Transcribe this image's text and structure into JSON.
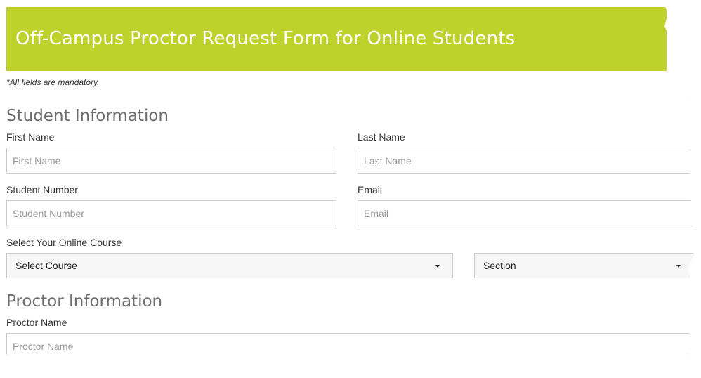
{
  "banner": {
    "title": "Off-Campus Proctor Request Form for Online Students",
    "color": "#bfd22b"
  },
  "notice": "*All fields are mandatory.",
  "student_section": {
    "heading": "Student Information",
    "first_name": {
      "label": "First Name",
      "placeholder": "First Name"
    },
    "last_name": {
      "label": "Last Name",
      "placeholder": "Last Name"
    },
    "student_number": {
      "label": "Student Number",
      "placeholder": "Student Number"
    },
    "email": {
      "label": "Email",
      "placeholder": "Email"
    },
    "course": {
      "label": "Select Your Online Course",
      "course_select": "Select Course",
      "section_select": "Section"
    }
  },
  "proctor_section": {
    "heading": "Proctor Information",
    "proctor_name": {
      "label": "Proctor Name",
      "placeholder": "Proctor Name"
    }
  }
}
